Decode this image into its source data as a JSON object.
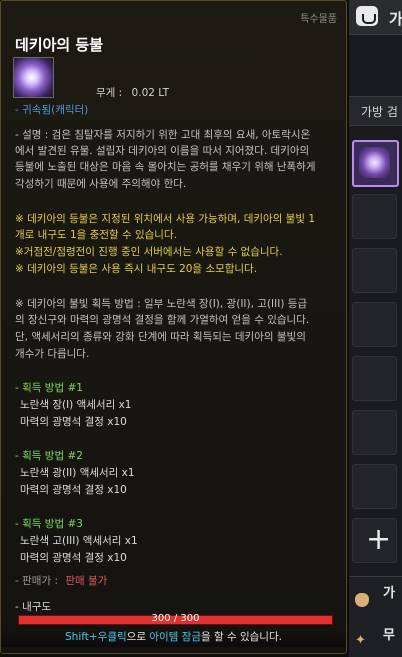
{
  "inventory": {
    "title": "가",
    "tab_label": "가방 검",
    "bottom_label_1": "가",
    "bottom_label_2": "무"
  },
  "tooltip": {
    "badge": "특수물품",
    "title": "데키아의 등불",
    "weight_label": "무게 :",
    "weight_value": "0.02 LT",
    "bound": "- 귀속됨(캐릭터)",
    "description": [
      "- 설명 : 검은 침탈자를 저지하기 위한 고대 최후의 요새, 아토락시온",
      "에서 발견된 유물. 설립자 데키아의 이름을 따서 지어졌다. 데키아의",
      "등불에 노출된 대상은 마음 속 몰아치는 공허를 채우기 위해 난폭하게",
      "각성하기 때문에 사용에 주의해야 한다."
    ],
    "notes": [
      "※ 데키아의 등불은 지정된 위치에서 사용 가능하며, 데키아의 불빛 1",
      "개로 내구도 1을 충전할 수 있습니다.",
      "※거점전/점령전이 진행 중인 서버에서는 사용할 수 없습니다.",
      "※ 데키아의 등불은 사용 즉시 내구도 20을 소모합니다."
    ],
    "acquire_info": [
      "※ 데키아의 불빛 획득 방법 : 일부 노란색 장(I), 광(II), 고(III) 등급",
      "의 장신구와 마력의 광명석 결정을 함께 가열하여 얻을 수 있습니다.",
      "단, 액세서리의 종류와 강화 단계에 따라 획득되는 데키아의 불빛의",
      "개수가 다릅니다."
    ],
    "methods": [
      {
        "header": "- 획득 방법 #1",
        "lines": [
          "노란색 장(I) 액세서리 x1",
          "마력의 광명석 결정 x10"
        ]
      },
      {
        "header": "- 획득 방법 #2",
        "lines": [
          "노란색 광(II) 액세서리 x1",
          "마력의 광명석 결정 x10"
        ]
      },
      {
        "header": "- 획득 방법 #3",
        "lines": [
          "노란색 고(III) 액세서리 x1",
          "마력의 광명석 결정 x10"
        ]
      }
    ],
    "sell_label": "- 판매가 :",
    "sell_value": "판매 불가",
    "durability_label": "- 내구도",
    "durability_text": "300 / 300",
    "durability_current": 300,
    "durability_max": 300,
    "hint_key": "Shift+우클릭",
    "hint_mid1": "으로 ",
    "hint_action": "아이템 잠금",
    "hint_end": "을 할 수 있습니다."
  },
  "colors": {
    "bound": "#4f9ad8",
    "note": "#e6cc4a",
    "method": "#7fd65a",
    "sell_value": "#e05858",
    "durability": "#e03030",
    "hint_key": "#48c8e8"
  },
  "icons": {
    "item_icon": "lantern-orb-icon",
    "inventory_logo": "bag-logo-icon",
    "add_slot": "plus-icon"
  }
}
